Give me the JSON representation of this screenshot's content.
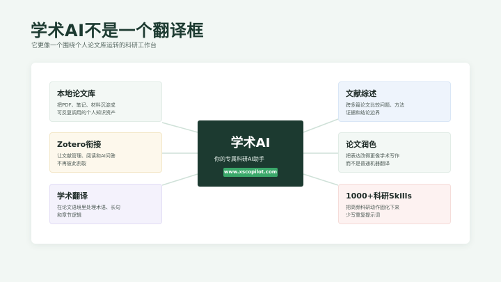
{
  "header": {
    "title": "学术AI不是一个翻译框",
    "subtitle": "它更像一个围绕个人论文库运转的科研工作台"
  },
  "center": {
    "title": "学术AI",
    "tagline": "你的专属科研AI助手",
    "link": "www.xscopilot.com"
  },
  "cards": [
    {
      "id": "library",
      "title": "本地论文库",
      "desc": "把PDF、笔记、材料沉淀成\n可反复调用的个人知识资产"
    },
    {
      "id": "zotero",
      "title": "Zotero衔接",
      "desc": "让文献管理、阅读和AI问答\n不再彼此割裂"
    },
    {
      "id": "translate",
      "title": "学术翻译",
      "desc": "在论文语境里处理术语、长句\n和章节逻辑"
    },
    {
      "id": "review",
      "title": "文献综述",
      "desc": "跨多篇论文比较问题、方法\n证据和结论边界"
    },
    {
      "id": "polish",
      "title": "论文润色",
      "desc": "把表达改得更像学术写作\n而不是普通机器翻译"
    },
    {
      "id": "skills",
      "title": "1000+科研Skills",
      "desc": "把高频科研动作固化下来\n少写重复提示词"
    }
  ],
  "colors": {
    "dark_green": "#1c3a30",
    "accent_green": "#3aa86a",
    "card_bg": [
      "#f3f8f5",
      "#fdf8ec",
      "#f4f2fc",
      "#eef4fc",
      "#f3f8f5",
      "#fdf2f1"
    ]
  }
}
